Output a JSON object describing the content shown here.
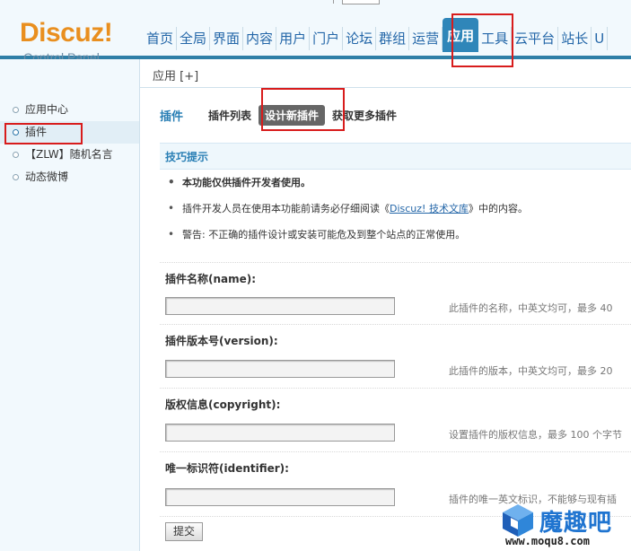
{
  "logo": {
    "main": "Discuz!",
    "sub": "Control Panel"
  },
  "nav": [
    "首页",
    "全局",
    "界面",
    "内容",
    "用户",
    "门户",
    "论坛",
    "群组",
    "运营",
    "应用",
    "工具",
    "云平台",
    "站长",
    "U"
  ],
  "nav_active_index": 9,
  "subheader": "应用  [+]",
  "sidebar": {
    "items": [
      "应用中心",
      "插件",
      "【ZLW】随机名言",
      "动态微博"
    ],
    "active_index": 1
  },
  "tabs": {
    "title": "插件",
    "items": [
      "插件列表",
      "设计新插件",
      "获取更多插件"
    ],
    "active_index": 1
  },
  "tips": {
    "heading": "技巧提示",
    "line1": "本功能仅供插件开发者使用。",
    "line2_before": "插件开发人员在使用本功能前请务必仔细阅读《",
    "line2_link": "Discuz! 技术文库",
    "line2_after": "》中的内容。",
    "line3": "警告: 不正确的插件设计或安装可能危及到整个站点的正常使用。"
  },
  "fields": [
    {
      "label": "插件名称(name):",
      "hint": "此插件的名称，中英文均可，最多 40",
      "value": ""
    },
    {
      "label": "插件版本号(version):",
      "hint": "此插件的版本，中英文均可，最多 20",
      "value": ""
    },
    {
      "label": "版权信息(copyright):",
      "hint": "设置插件的版权信息，最多 100 个字节",
      "value": ""
    },
    {
      "label": "唯一标识符(identifier):",
      "hint": "插件的唯一英文标识，不能够与现有插",
      "value": ""
    }
  ],
  "submit_label": "提交",
  "watermark": {
    "text": "魔趣吧",
    "url": "www.moqu8.com"
  },
  "colors": {
    "accent": "#2f86b9",
    "highlight": "#d81c1c",
    "logo": "#e98f1f"
  }
}
